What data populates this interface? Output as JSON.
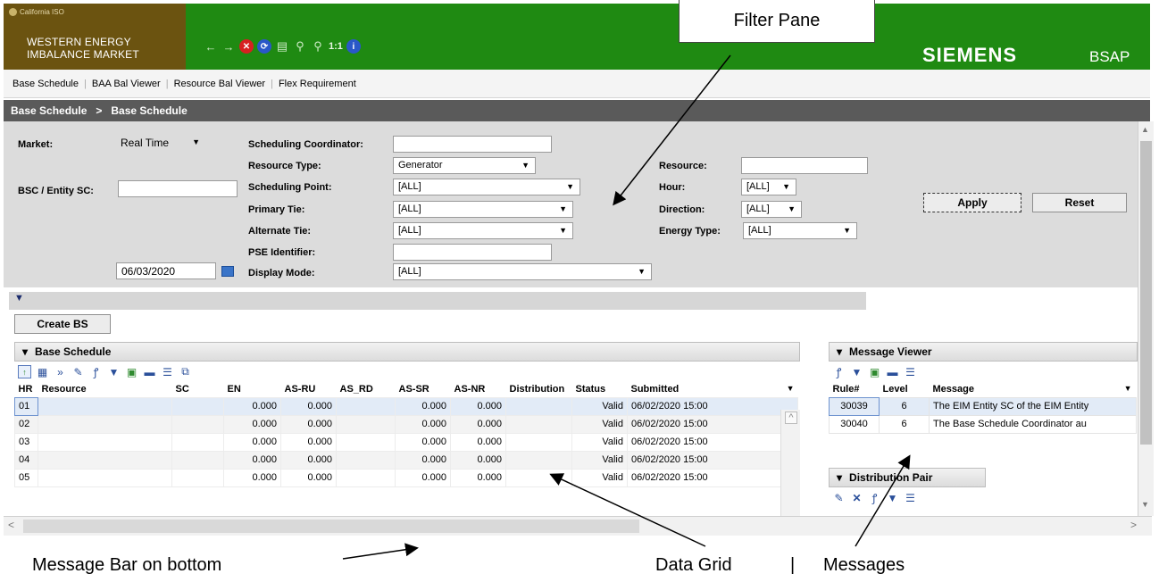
{
  "header": {
    "cal_iso": "California ISO",
    "brand_line1": "WESTERN ENERGY",
    "brand_line2": "IMBALANCE MARKET",
    "zoom_label": "1:1",
    "siemens": "SIEMENS",
    "bsap": "BSAP"
  },
  "nav": {
    "items": [
      "Base Schedule",
      "BAA Bal Viewer",
      "Resource Bal Viewer",
      "Flex Requirement"
    ]
  },
  "breadcrumb": {
    "parent": "Base Schedule",
    "sep": ">",
    "current": "Base Schedule"
  },
  "filters": {
    "market_label": "Market:",
    "market_value": "Real Time",
    "bsc_label": "BSC / Entity SC:",
    "bsc_value": "",
    "date_value": "06/03/2020",
    "sc_label": "Scheduling Coordinator:",
    "sc_value": "",
    "resource_type_label": "Resource Type:",
    "resource_type_value": "Generator",
    "scheduling_point_label": "Scheduling Point:",
    "scheduling_point_value": "[ALL]",
    "primary_tie_label": "Primary Tie:",
    "primary_tie_value": "[ALL]",
    "alternate_tie_label": "Alternate Tie:",
    "alternate_tie_value": "[ALL]",
    "pse_label": "PSE Identifier:",
    "pse_value": "",
    "display_mode_label": "Display Mode:",
    "display_mode_value": "[ALL]",
    "resource_label": "Resource:",
    "resource_value": "",
    "hour_label": "Hour:",
    "hour_value": "[ALL]",
    "direction_label": "Direction:",
    "direction_value": "[ALL]",
    "energy_type_label": "Energy Type:",
    "energy_type_value": "[ALL]",
    "apply": "Apply",
    "reset": "Reset"
  },
  "create_bs": "Create BS",
  "grid": {
    "title": "Base Schedule",
    "columns": [
      "HR",
      "Resource",
      "SC",
      "EN",
      "AS-RU",
      "AS_RD",
      "AS-SR",
      "AS-NR",
      "Distribution",
      "Status",
      "Submitted"
    ],
    "rows": [
      {
        "hr": "01",
        "en": "0.000",
        "asru": "0.000",
        "assr": "0.000",
        "asnr": "0.000",
        "status": "Valid",
        "submitted": "06/02/2020 15:00"
      },
      {
        "hr": "02",
        "en": "0.000",
        "asru": "0.000",
        "assr": "0.000",
        "asnr": "0.000",
        "status": "Valid",
        "submitted": "06/02/2020 15:00"
      },
      {
        "hr": "03",
        "en": "0.000",
        "asru": "0.000",
        "assr": "0.000",
        "asnr": "0.000",
        "status": "Valid",
        "submitted": "06/02/2020 15:00"
      },
      {
        "hr": "04",
        "en": "0.000",
        "asru": "0.000",
        "assr": "0.000",
        "asnr": "0.000",
        "status": "Valid",
        "submitted": "06/02/2020 15:00"
      },
      {
        "hr": "05",
        "en": "0.000",
        "asru": "0.000",
        "assr": "0.000",
        "asnr": "0.000",
        "status": "Valid",
        "submitted": "06/02/2020 15:00"
      }
    ]
  },
  "messages": {
    "title": "Message Viewer",
    "columns": [
      "Rule#",
      "Level",
      "Message"
    ],
    "rows": [
      {
        "rule": "30039",
        "level": "6",
        "message": "The EIM Entity SC of the EIM Entity"
      },
      {
        "rule": "30040",
        "level": "6",
        "message": "The Base Schedule Coordinator au"
      }
    ]
  },
  "distribution": {
    "title": "Distribution Pair"
  },
  "annotations": {
    "filter_pane": "Filter Pane",
    "message_bar": "Message Bar on bottom",
    "data_grid": "Data Grid",
    "divider": "|",
    "messages": "Messages"
  },
  "colors": {
    "header_green": "#1f8a12",
    "brand_brown": "#6b5310",
    "breadcrumb": "#5a5a5a",
    "filter_bg": "#dcdcdc"
  }
}
